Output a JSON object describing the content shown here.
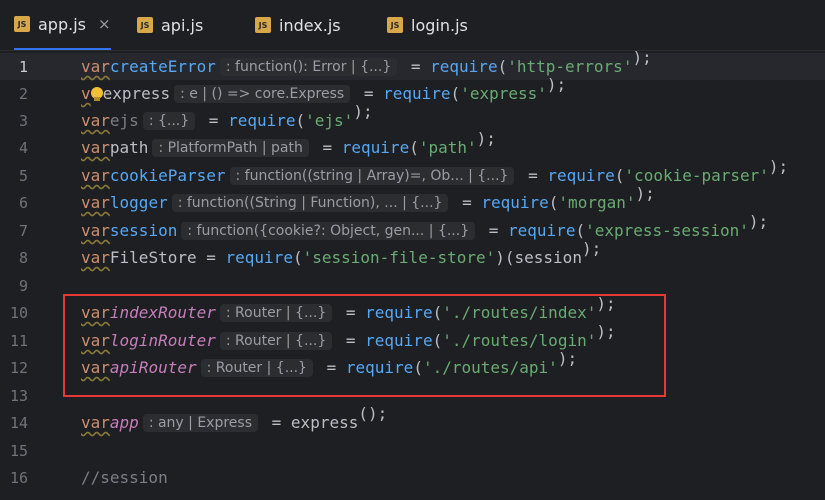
{
  "tabs": [
    {
      "label": "app.js",
      "badge": "JS",
      "active": true,
      "close": "×"
    },
    {
      "label": "api.js",
      "badge": "JS",
      "active": false
    },
    {
      "label": "index.js",
      "badge": "JS",
      "active": false
    },
    {
      "label": "login.js",
      "badge": "JS",
      "active": false
    }
  ],
  "lines": {
    "n1": "1",
    "n2": "2",
    "n3": "3",
    "n4": "4",
    "n5": "5",
    "n6": "6",
    "n7": "7",
    "n8": "8",
    "n9": "9",
    "n10": "10",
    "n11": "11",
    "n12": "12",
    "n13": "13",
    "n14": "14",
    "n15": "15",
    "n16": "16"
  },
  "code": {
    "kw_var": "var",
    "require": "require",
    "l1_name": "createError",
    "l1_hint": ": function(): Error | {...}",
    "l1_str": "'http-errors'",
    "l2_name": "express",
    "l2_hint": ": e | () => core.Express",
    "l2_str": "'express'",
    "l3_name": "ejs",
    "l3_hint": ": {...}",
    "l3_str": "'ejs'",
    "l4_name": "path",
    "l4_hint": ": PlatformPath | path",
    "l4_str": "'path'",
    "l5_name": "cookieParser",
    "l5_hint": ": function((string | Array)=, Ob... | {...}",
    "l5_str": "'cookie-parser'",
    "l6_name": "logger",
    "l6_hint": ": function((String | Function), ... | {...}",
    "l6_str": "'morgan'",
    "l7_name": "session",
    "l7_hint": ": function({cookie?: Object, gen... | {...}",
    "l7_str": "'express-session'",
    "l8_name": "FileStore",
    "l8_str": "'session-file-store'",
    "l8_arg": "session",
    "l10_name": "indexRouter",
    "l10_hint": ": Router | {...}",
    "l10_str": "'./routes/index'",
    "l11_name": "loginRouter",
    "l11_hint": ": Router | {...}",
    "l11_str": "'./routes/login'",
    "l12_name": "apiRouter",
    "l12_hint": ": Router | {...}",
    "l12_str": "'./routes/api'",
    "l14_name": "app",
    "l14_hint": ": any | Express",
    "l14_call": "express",
    "l16_comment": "//session"
  },
  "colors": {
    "highlight_box": "#e53935",
    "keyword": "#cf8e6d",
    "function": "#56a8f5",
    "string": "#6aab73"
  }
}
